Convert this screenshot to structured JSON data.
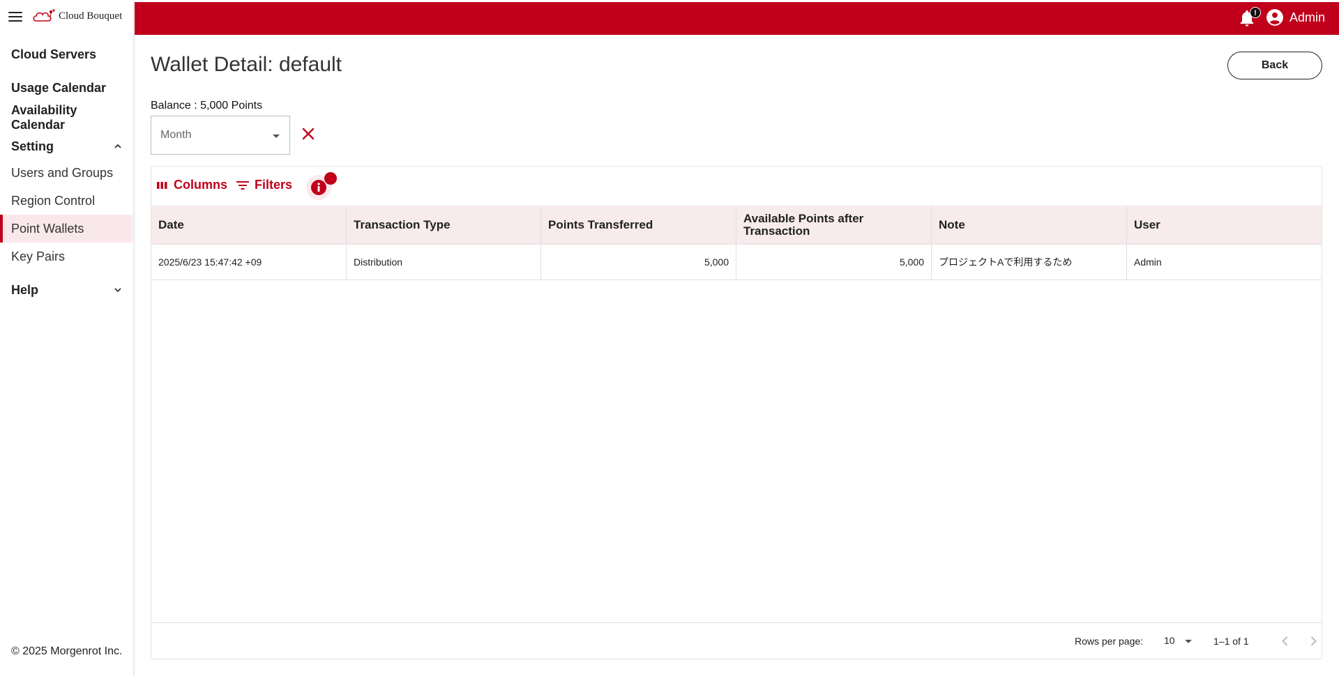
{
  "app": {
    "logo_text": "Cloud Bouquet"
  },
  "topbar": {
    "notification_count": "!",
    "user_name": "Admin"
  },
  "sidebar": {
    "items": [
      {
        "label": "Cloud Servers"
      },
      {
        "label": "Usage Calendar"
      },
      {
        "label": "Availability Calendar"
      },
      {
        "label": "Setting"
      },
      {
        "label": "Users and Groups"
      },
      {
        "label": "Region Control"
      },
      {
        "label": "Point Wallets"
      },
      {
        "label": "Key Pairs"
      },
      {
        "label": "Help"
      }
    ],
    "footer": "© 2025 Morgenrot Inc."
  },
  "page": {
    "title": "Wallet Detail: default",
    "back_label": "Back",
    "balance": "Balance : 5,000 Points",
    "month_placeholder": "Month"
  },
  "grid": {
    "toolbar": {
      "columns_label": "Columns",
      "filters_label": "Filters"
    },
    "headers": [
      "Date",
      "Transaction Type",
      "Points Transferred",
      "Available Points after Transaction",
      "Note",
      "User"
    ],
    "rows": [
      [
        "2025/6/23 15:47:42 +09",
        "Distribution",
        "5,000",
        "5,000",
        "プロジェクトAで利用するため",
        "Admin"
      ]
    ],
    "footer": {
      "rows_per_page_label": "Rows per page:",
      "rows_per_page_value": "10",
      "range": "1–1 of 1"
    }
  },
  "colors": {
    "brand": "#c0001a",
    "header_bg": "#f7ebec",
    "active_bg": "#f9e8ea"
  }
}
